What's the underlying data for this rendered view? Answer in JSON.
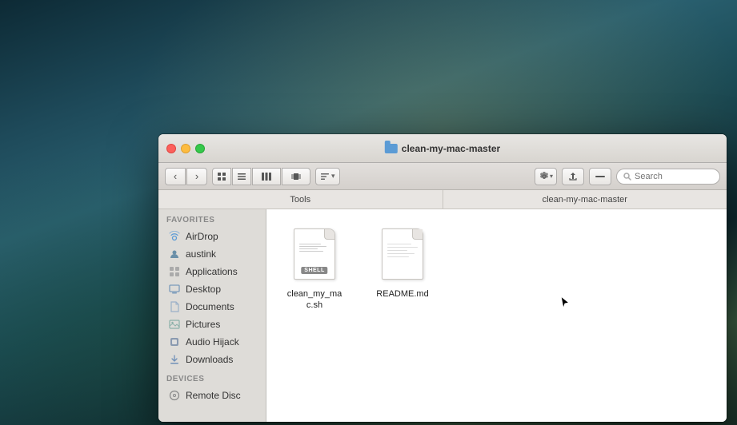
{
  "window": {
    "title": "clean-my-mac-master",
    "traffic_lights": [
      "close",
      "minimize",
      "maximize"
    ]
  },
  "toolbar": {
    "nav_back": "‹",
    "nav_forward": "›",
    "view_icon1": "⊞",
    "view_icon2": "≡",
    "view_icon3": "⊟",
    "view_icon4": "⊠",
    "view_icon5": "⊟",
    "action_gear": "⚙",
    "action_chevron": "▾",
    "action_share": "↑",
    "action_tag": "—",
    "search_placeholder": "Search"
  },
  "path_bar": {
    "segment1": "Tools",
    "segment2": "clean-my-mac-master"
  },
  "sidebar": {
    "favorites_header": "Favorites",
    "items": [
      {
        "id": "airdrop",
        "label": "AirDrop",
        "icon": "airdrop"
      },
      {
        "id": "austink",
        "label": "austink",
        "icon": "user"
      },
      {
        "id": "applications",
        "label": "Applications",
        "icon": "apps"
      },
      {
        "id": "desktop",
        "label": "Desktop",
        "icon": "desktop"
      },
      {
        "id": "documents",
        "label": "Documents",
        "icon": "docs"
      },
      {
        "id": "pictures",
        "label": "Pictures",
        "icon": "pics"
      },
      {
        "id": "audio-hijack",
        "label": "Audio Hijack",
        "icon": "audio"
      },
      {
        "id": "downloads",
        "label": "Downloads",
        "icon": "dl"
      }
    ],
    "devices_header": "Devices",
    "devices": [
      {
        "id": "remote-disc",
        "label": "Remote Disc",
        "icon": "remote"
      }
    ]
  },
  "files": [
    {
      "id": "shell-script",
      "name": "clean_my_mac.sh",
      "type": "shell",
      "badge": "SHELL"
    },
    {
      "id": "readme",
      "name": "README.md",
      "type": "md"
    }
  ]
}
